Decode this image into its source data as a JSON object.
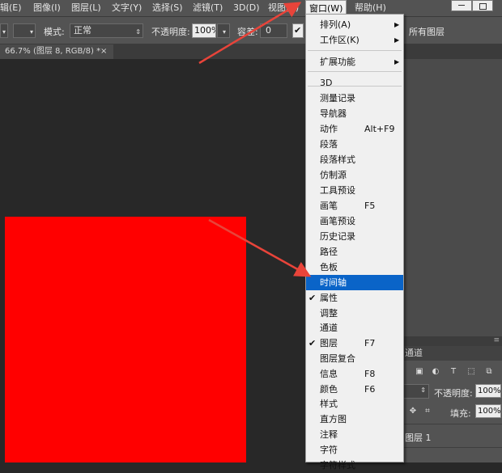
{
  "menubar": {
    "items": [
      "辑(E)",
      "图像(I)",
      "图层(L)",
      "文字(Y)",
      "选择(S)",
      "滤镜(T)",
      "3D(D)",
      "视图(V)",
      "窗口(W)",
      "帮助(H)"
    ]
  },
  "options_bar": {
    "mode_label": "模式:",
    "mode_value": "正常",
    "opacity_label": "不透明度:",
    "opacity_value": "100%",
    "tolerance_label": "容差:",
    "tolerance_value": "0",
    "all_layers_label": "所有图层"
  },
  "document_tab": {
    "title": "66.7% (图层 8, RGB/8) *",
    "close": "×"
  },
  "window_menu": {
    "items": [
      {
        "label": "排列(A)",
        "submenu": true
      },
      {
        "label": "工作区(K)",
        "submenu": true
      },
      {
        "label": "扩展功能",
        "submenu": true
      },
      {
        "label": "3D"
      },
      {
        "label": "测量记录"
      },
      {
        "label": "导航器"
      },
      {
        "label": "动作",
        "shortcut": "Alt+F9"
      },
      {
        "label": "段落"
      },
      {
        "label": "段落样式"
      },
      {
        "label": "仿制源"
      },
      {
        "label": "工具预设"
      },
      {
        "label": "画笔",
        "shortcut": "F5"
      },
      {
        "label": "画笔预设"
      },
      {
        "label": "历史记录"
      },
      {
        "label": "路径"
      },
      {
        "label": "色板"
      },
      {
        "label": "时间轴",
        "highlighted": true
      },
      {
        "label": "属性",
        "checked": true
      },
      {
        "label": "调整"
      },
      {
        "label": "通道"
      },
      {
        "label": "图层",
        "shortcut": "F7",
        "checked": true
      },
      {
        "label": "图层复合"
      },
      {
        "label": "信息",
        "shortcut": "F8"
      },
      {
        "label": "颜色",
        "shortcut": "F6"
      },
      {
        "label": "样式"
      },
      {
        "label": "直方图"
      },
      {
        "label": "注释"
      },
      {
        "label": "字符"
      },
      {
        "label": "字符样式"
      }
    ],
    "submenu_glyph": "▶",
    "check_glyph": "✔"
  },
  "layers_panel": {
    "tab_label": "通道",
    "opacity_label": "不透明度:",
    "opacity_value": "100%",
    "fill_label": "填充:",
    "fill_value": "100%",
    "layer_name": "图层 1"
  },
  "colors": {
    "canvas_fill": "#ff0000",
    "highlight": "#0a64c8",
    "annotation_arrow": "#e8443a"
  },
  "icons": [
    "close-window-icon",
    "restore-window-icon",
    "image-filter-icon",
    "adjustment-filter-icon",
    "text-filter-icon",
    "shape-filter-icon",
    "smart-filter-icon",
    "move-lock-icon",
    "checkmark-icon",
    "submenu-arrow-icon"
  ]
}
